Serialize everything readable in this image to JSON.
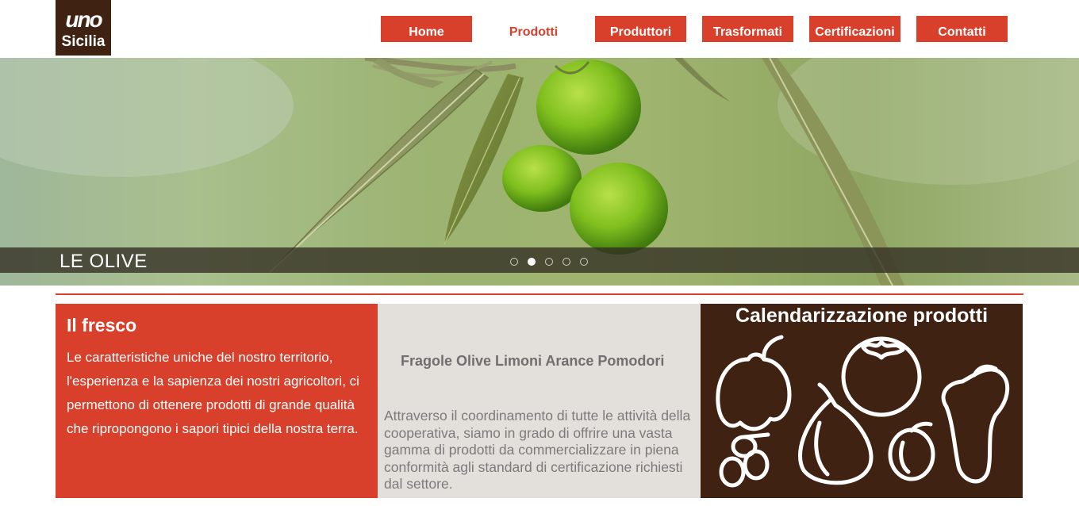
{
  "brand": {
    "logo_line1": "uno",
    "logo_line2": "Sicilia",
    "logo_color": "#3f2212",
    "accent_color": "#d8402b"
  },
  "nav": {
    "items": [
      {
        "label": "Home"
      },
      {
        "label": "Prodotti"
      },
      {
        "label": "Produttori"
      },
      {
        "label": "Trasformati"
      },
      {
        "label": "Certificazioni"
      },
      {
        "label": "Contatti"
      }
    ],
    "active": "Prodotti"
  },
  "hero": {
    "caption": "LE OLIVE",
    "slide_count": 5,
    "active_slide": 2
  },
  "fresco": {
    "title": "Il fresco",
    "text": "Le caratteristiche uniche del nostro territorio, l'esperienza e la sapienza dei nostri agricoltori, ci permettono di ottenere prodotti di grande qualità che ripropongono i sapori tipici della nostra terra."
  },
  "middle": {
    "products": "Fragole Olive Limoni Arance Pomodori",
    "description": "Attraverso il coordinamento di tutte le attività della cooperativa, siamo in grado di offrire una vasta gamma di prodotti da commercializzare in piena conformità agli standard di certificazione richiesti dal settore."
  },
  "calendar": {
    "title": "Calendarizzazione prodotti",
    "background_color": "#3f2212"
  }
}
